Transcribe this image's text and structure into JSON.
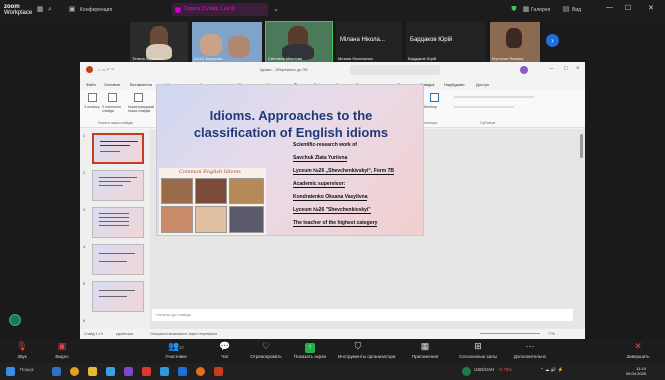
{
  "zoom": {
    "logo_line1": "zoom",
    "logo_line2": "Workplace",
    "meeting_label": "Конференция",
    "pill_text": "Tаруса (Cлайд 1 из 9)",
    "right_text": "Галерея",
    "view_label": "Вид"
  },
  "participants": [
    {
      "name": "Тетяна Кирилюк"
    },
    {
      "name": "БЛАЗ Академія ...",
      "sub": "ОСТРОЖСЬКОГО"
    },
    {
      "name": "Світлана Миклова"
    },
    {
      "name": "Мілана Ніколаєнко",
      "big": "Мілана Нікола..."
    },
    {
      "name": "Бардаков Юрій",
      "big": "Бардаков Юрій"
    },
    {
      "name": "Мунтаян Ясмина"
    }
  ],
  "ppt": {
    "title_text": "Ідіоми - Збережено до ПК",
    "tabs": [
      "Файл",
      "Основне",
      "Вставлення",
      "Малювання",
      "Конструктор",
      "Переходи",
      "Анімація",
      "Показ слайдів",
      "Запис",
      "Рецензування",
      "Вигляд",
      "Довідка",
      "Надбудови",
      "Доступ"
    ],
    "selected_tab": "Показ слайдів",
    "ribbon": {
      "b1": "З початку",
      "b2": "З поточного слайда",
      "b3": "Користувацький показ слайдів",
      "group1": "Почати показ слайдів",
      "group2": "Настроювання",
      "group3": "Монітори",
      "group4": "Субтитри",
      "monitor": "Монітор"
    },
    "notes_placeholder": "Нотатки до слайда",
    "status_left": "Слайд 1 з 9",
    "status_lang": "українська",
    "status_access": "Спеціальні можливості: варто перевірити",
    "zoom_level": "77%"
  },
  "slide": {
    "title_line1": "Idioms. Approaches to the",
    "title_line2": "classification of English idioms",
    "lines": [
      "Scientific-research work of",
      "Savchuk Zlata Yuriivna",
      "Lyceum №26 „Shevchenkivskyi“, Form 7B",
      "Academic supervisor:",
      "Kondratenko Oksana Vasylivna",
      "Lyceum №26 \"Shevchenkivskyi\"",
      "The teacher of the highest category"
    ],
    "collage_title": "Common English Idioms"
  },
  "toolbar": {
    "audio": "Звук",
    "video": "Видео",
    "participants": "Участники",
    "participants_count": "27",
    "chat": "Чат",
    "reactions": "Отреагировать",
    "share": "Показать экран",
    "host_tools": "Инструменты организатора",
    "apps": "Приложения",
    "breakout": "Сессионные залы",
    "more": "Дополнительно",
    "end": "Завершить"
  },
  "taskbar": {
    "search": "Пошук",
    "currency": "USD/UAH",
    "currency_change": "-0,78%",
    "time": "11:10",
    "date": "05.04.2025"
  },
  "colors": {
    "ppt_accent": "#c43e1c",
    "slide_title": "#1f3a7a",
    "zoom_bg": "#1c1c1c"
  }
}
